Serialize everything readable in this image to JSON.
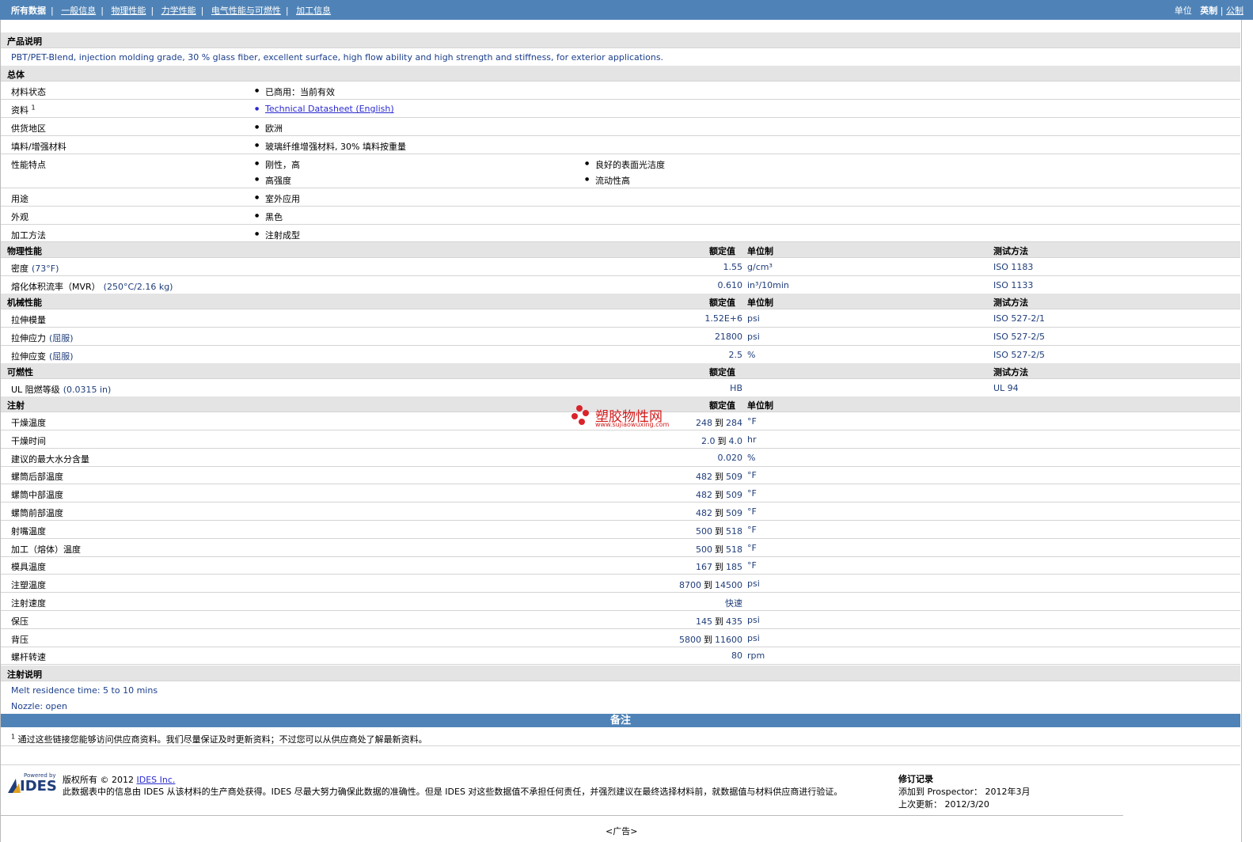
{
  "nav": {
    "items": [
      "所有数据",
      "一般信息",
      "物理性能",
      "力学性能",
      "电气性能与可燃性",
      "加工信息"
    ]
  },
  "units": {
    "label": "单位",
    "imperial": "英制",
    "metric": "公制"
  },
  "desc": {
    "title": "产品说明",
    "text": "PBT/PET-Blend, injection molding grade, 30 % glass fiber, excellent surface, high flow ability and high strength and stiffness, for exterior applications."
  },
  "general": {
    "title": "总体",
    "status_label": "材料状态",
    "status_value": "已商用：当前有效",
    "docs_label": "资料",
    "docs_sup": "1",
    "docs_link": "Technical Datasheet (English)",
    "region_label": "供货地区",
    "region_value": "欧洲",
    "filler_label": "填料/增强材料",
    "filler_value": "玻璃纤维增强材料, 30% 填料按重量",
    "features_label": "性能特点",
    "features": [
      "刚性，高",
      "良好的表面光洁度",
      "高强度",
      "流动性高"
    ],
    "use_label": "用途",
    "use_value": "室外应用",
    "look_label": "外观",
    "look_value": "黑色",
    "proc_label": "加工方法",
    "proc_value": "注射成型"
  },
  "headers": {
    "nominal": "额定值",
    "unit": "单位制",
    "method": "测试方法"
  },
  "physical": {
    "title": "物理性能",
    "rows": [
      {
        "name": "密度",
        "cond": "(73°F)",
        "value": "1.55",
        "unit": "g/cm³",
        "method": "ISO 1183"
      },
      {
        "name": "熔化体积流率（MVR）",
        "cond": "(250°C/2.16 kg)",
        "value": "0.610",
        "unit": "in³/10min",
        "method": "ISO 1133"
      }
    ]
  },
  "mechanical": {
    "title": "机械性能",
    "rows": [
      {
        "name": "拉伸模量",
        "cond": "",
        "value": "1.52E+6",
        "unit": "psi",
        "method": "ISO 527-2/1"
      },
      {
        "name": "拉伸应力",
        "cond": "(屈服)",
        "value": "21800",
        "unit": "psi",
        "method": "ISO 527-2/5"
      },
      {
        "name": "拉伸应变",
        "cond": "(屈服)",
        "value": "2.5",
        "unit": "%",
        "method": "ISO 527-2/5"
      }
    ]
  },
  "flammability": {
    "title": "可燃性",
    "rows": [
      {
        "name": "UL 阻燃等级",
        "cond": "(0.0315 in)",
        "value": "HB",
        "unit": "",
        "method": "UL 94"
      }
    ]
  },
  "injection": {
    "title": "注射",
    "rows": [
      {
        "name": "干燥温度",
        "a": "248",
        "to": "到",
        "b": "284",
        "unit": "°F"
      },
      {
        "name": "干燥时间",
        "a": "2.0",
        "to": "到",
        "b": "4.0",
        "unit": "hr"
      },
      {
        "name": "建议的最大水分含量",
        "a": "",
        "to": "",
        "b": "0.020",
        "unit": "%"
      },
      {
        "name": "螺筒后部温度",
        "a": "482",
        "to": "到",
        "b": "509",
        "unit": "°F"
      },
      {
        "name": "螺筒中部温度",
        "a": "482",
        "to": "到",
        "b": "509",
        "unit": "°F"
      },
      {
        "name": "螺筒前部温度",
        "a": "482",
        "to": "到",
        "b": "509",
        "unit": "°F"
      },
      {
        "name": "射嘴温度",
        "a": "500",
        "to": "到",
        "b": "518",
        "unit": "°F"
      },
      {
        "name": "加工（熔体）温度",
        "a": "500",
        "to": "到",
        "b": "518",
        "unit": "°F"
      },
      {
        "name": "模具温度",
        "a": "167",
        "to": "到",
        "b": "185",
        "unit": "°F"
      },
      {
        "name": "注塑温度",
        "a": "8700",
        "to": "到",
        "b": "14500",
        "unit": "psi"
      },
      {
        "name": "注射速度",
        "a": "",
        "to": "",
        "b": "快速",
        "unit": ""
      },
      {
        "name": "保压",
        "a": "145",
        "to": "到",
        "b": "435",
        "unit": "psi"
      },
      {
        "name": "背压",
        "a": "5800",
        "to": "到",
        "b": "11600",
        "unit": "psi"
      },
      {
        "name": "螺杆转速",
        "a": "",
        "to": "",
        "b": "80",
        "unit": "rpm"
      }
    ]
  },
  "inj_notes": {
    "title": "注射说明",
    "lines": [
      "Melt residence time: 5 to 10 mins",
      "Nozzle: open"
    ]
  },
  "remarks": {
    "title": "备注",
    "sup": "1",
    "text": "通过这些链接您能够访问供应商资料。我们尽量保证及时更新资料；不过您可以从供应商处了解最新资料。"
  },
  "footer": {
    "logo_small": "Powered by",
    "logo": "IDES",
    "copyright": "版权所有 © 2012",
    "ides_link": "IDES Inc.",
    "disclaimer": "此数据表中的信息由 IDES 从该材料的生产商处获得。IDES 尽最大努力确保此数据的准确性。但是 IDES 对这些数据值不承担任何责任，并强烈建议在最终选择材料前，就数据值与材料供应商进行验证。",
    "rev_title": "修订记录",
    "added": "添加到 Prospector： 2012年3月",
    "updated": "上次更新： 2012/3/20",
    "ad": "<广告>"
  },
  "watermark": {
    "title": "塑胶物性网",
    "url": "www.sujiaowuxing.com"
  }
}
